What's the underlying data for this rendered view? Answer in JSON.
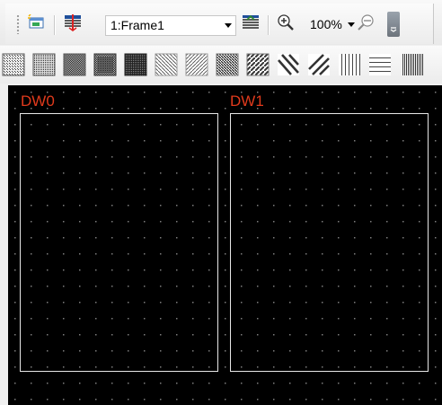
{
  "toolbar": {
    "frame_selector": {
      "value": "1:Frame1"
    },
    "zoom": {
      "value": "100%"
    },
    "icons": {
      "new_window": "new-window-icon",
      "frame_list": "frame-list-icon",
      "frame_properties": "frame-properties-icon",
      "zoom_in": "zoom-in-icon",
      "zoom_out": "zoom-out-icon"
    }
  },
  "patterns": [
    "pattern-dots-fine",
    "pattern-dots-medium",
    "pattern-dots-dense",
    "pattern-checker-coarse",
    "pattern-checker-dense",
    "pattern-diagonal-light",
    "pattern-diagonal-medium",
    "pattern-diagonal-dark",
    "pattern-diagonal-thick",
    "pattern-backslash",
    "pattern-slash-thick",
    "pattern-vertical-lines",
    "pattern-horizontal-lines",
    "pattern-vertical-dense"
  ],
  "canvas": {
    "grid_color": "#7d7d7d",
    "background_color": "#000000",
    "windows": [
      {
        "label": "DW0",
        "label_color": "#e03a1c"
      },
      {
        "label": "DW1",
        "label_color": "#e03a1c"
      }
    ]
  }
}
